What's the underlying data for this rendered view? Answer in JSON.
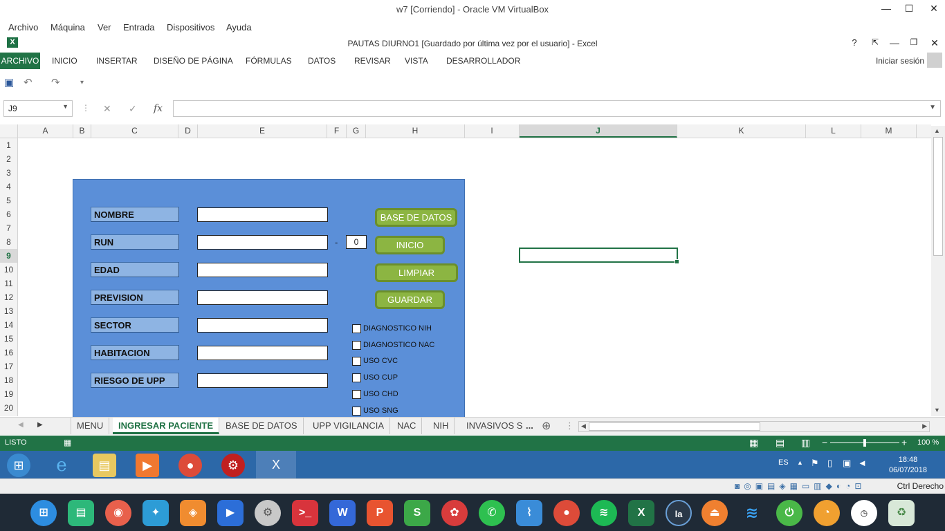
{
  "vbox": {
    "title": "w7 [Corriendo] - Oracle VM VirtualBox",
    "menu": [
      "Archivo",
      "Máquina",
      "Ver",
      "Entrada",
      "Dispositivos",
      "Ayuda"
    ],
    "host_key": "Ctrl Derecho"
  },
  "excel": {
    "title": "PAUTAS DIURNO1 [Guardado por última vez por el usuario] - Excel",
    "help": "?",
    "tabs": [
      "ARCHIVO",
      "INICIO",
      "INSERTAR",
      "DISEÑO DE PÁGINA",
      "FÓRMULAS",
      "DATOS",
      "REVISAR",
      "VISTA",
      "DESARROLLADOR"
    ],
    "signin": "Iniciar sesión",
    "namebox": "J9",
    "fx": "fx",
    "columns": [
      "A",
      "B",
      "C",
      "D",
      "E",
      "F",
      "G",
      "H",
      "I",
      "J",
      "K",
      "L",
      "M"
    ],
    "rows": [
      "1",
      "2",
      "3",
      "4",
      "5",
      "6",
      "7",
      "8",
      "9",
      "10",
      "11",
      "12",
      "13",
      "14",
      "15",
      "16",
      "17",
      "18",
      "19",
      "20"
    ],
    "selected_column": "J",
    "selected_row": "9"
  },
  "form": {
    "labels": {
      "nombre": "NOMBRE",
      "run": "RUN",
      "edad": "EDAD",
      "prevision": "PREVISION",
      "sector": "SECTOR",
      "habitacion": "HABITACION",
      "riesgo": "RIESGO DE UPP"
    },
    "run_separator": "-",
    "dv_value": "0",
    "buttons": {
      "base_datos": "BASE DE DATOS",
      "inicio": "INICIO",
      "limpiar": "LIMPIAR",
      "guardar": "GUARDAR"
    },
    "checkboxes": {
      "dx_nih": "DIAGNOSTICO NIH",
      "dx_nac": "DIAGNOSTICO NAC",
      "cvc": "USO CVC",
      "cup": "USO CUP",
      "chd": "USO CHD",
      "sng": "USO SNG"
    }
  },
  "sheets": {
    "tabs": [
      "MENU",
      "INGRESAR PACIENTE",
      "BASE DE DATOS",
      "UPP VIGILANCIA",
      "NAC",
      "NIH",
      "INVASIVOS S"
    ],
    "active": "INGRESAR PACIENTE",
    "more": "..."
  },
  "statusbar": {
    "ready": "LISTO",
    "zoom": "100 %",
    "zoom_fraction": 0.5
  },
  "taskbar": {
    "lang": "ES",
    "time": "18:48",
    "date": "06/07/2018"
  },
  "colors": {
    "excel_green": "#217346",
    "form_bg": "#5b8fd8",
    "label_bg": "#8eb4e3",
    "button_bg": "#8cb542"
  }
}
